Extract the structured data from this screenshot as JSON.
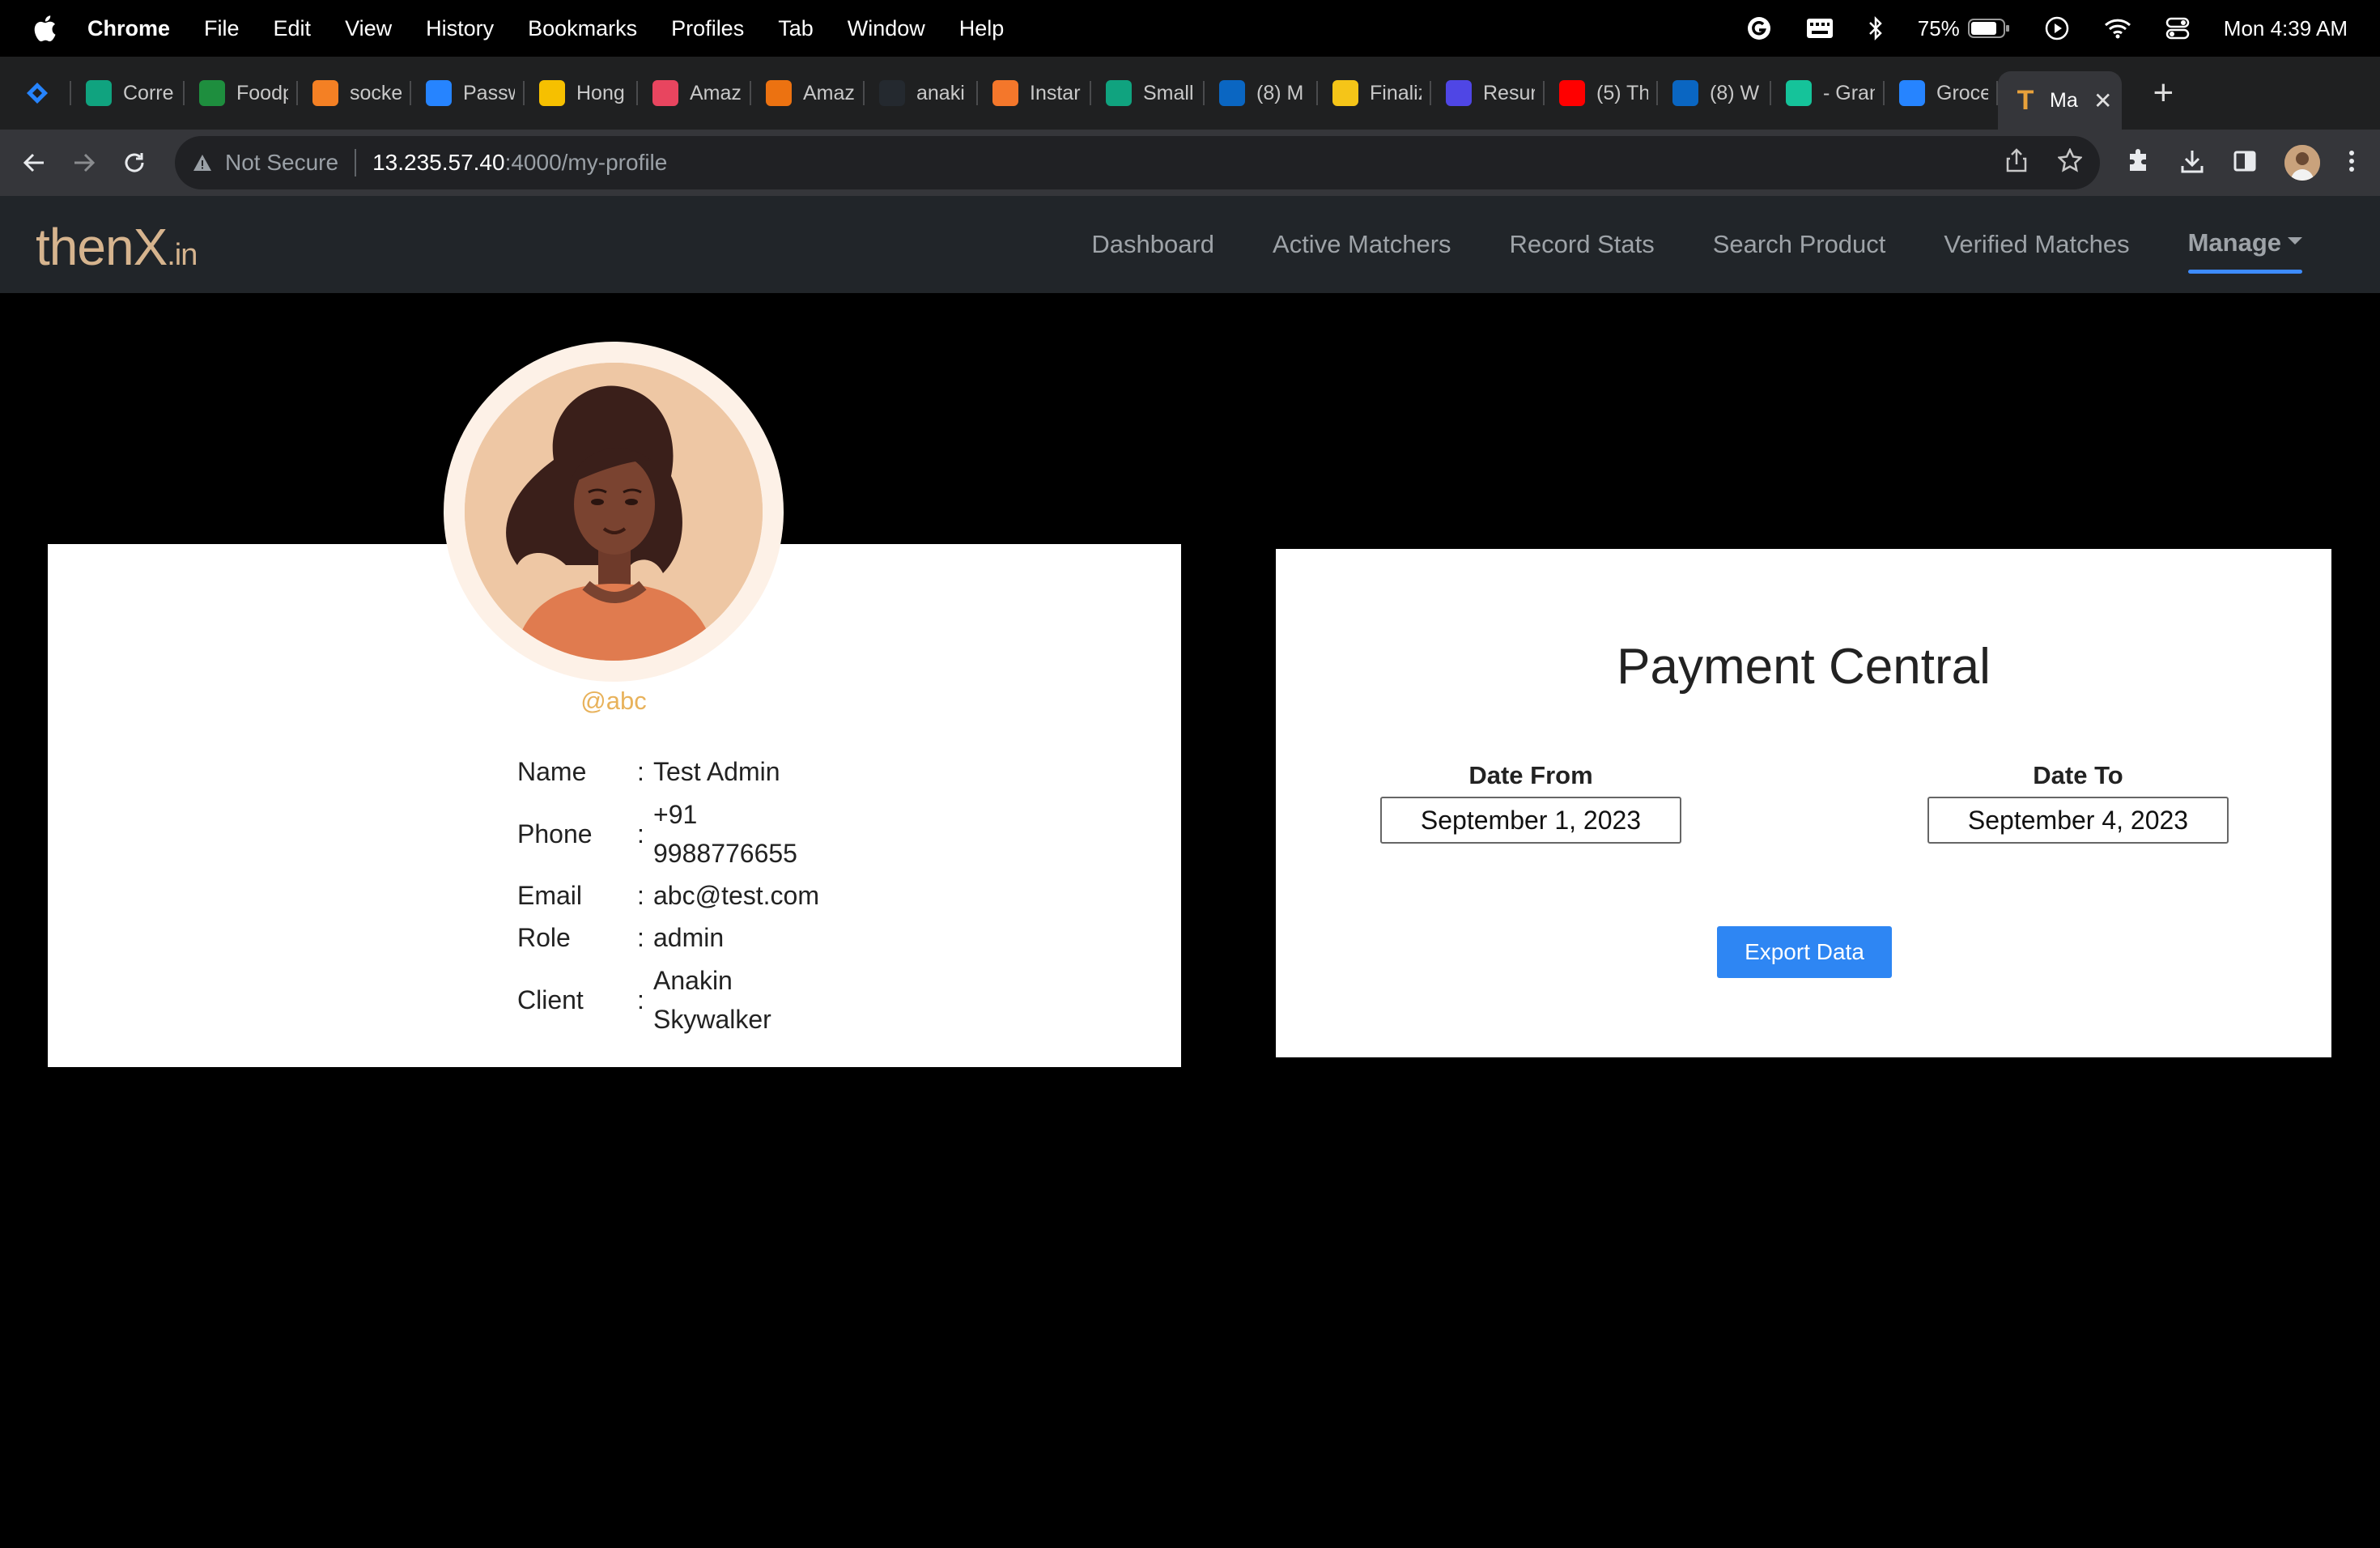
{
  "menubar": {
    "app": "Chrome",
    "items": [
      "File",
      "Edit",
      "View",
      "History",
      "Bookmarks",
      "Profiles",
      "Tab",
      "Window",
      "Help"
    ],
    "battery": "75%",
    "clock": "Mon 4:39 AM"
  },
  "tabs": [
    {
      "label": "",
      "color": "#1f6feb"
    },
    {
      "label": "Corre",
      "color": "#10a37f"
    },
    {
      "label": "Foodp",
      "color": "#1e8e3e"
    },
    {
      "label": "socke",
      "color": "#f48024"
    },
    {
      "label": "Passw",
      "color": "#2684ff"
    },
    {
      "label": "Hong",
      "color": "#f6c000"
    },
    {
      "label": "Amaz",
      "color": "#e8455f"
    },
    {
      "label": "Amaz",
      "color": "#ec7211"
    },
    {
      "label": "anaki",
      "color": "#24292f"
    },
    {
      "label": "Instar",
      "color": "#f4772b"
    },
    {
      "label": "Small",
      "color": "#10a37f"
    },
    {
      "label": "(8) M",
      "color": "#0a66c2"
    },
    {
      "label": "Finaliz",
      "color": "#f5c518"
    },
    {
      "label": "Resur",
      "color": "#4f46e5"
    },
    {
      "label": "(5) Th",
      "color": "#ff0000"
    },
    {
      "label": "(8) W",
      "color": "#0a66c2"
    },
    {
      "label": "- Gran",
      "color": "#15c39a"
    },
    {
      "label": "Groce",
      "color": "#2684ff"
    }
  ],
  "active_tab": {
    "label": "Ma",
    "favicon_letter": "T",
    "color": "#e8a13a"
  },
  "address": {
    "security": "Not Secure",
    "host": "13.235.57.40",
    "path": ":4000/my-profile"
  },
  "site": {
    "logo_main": "thenX",
    "logo_suffix": ".in",
    "nav": [
      "Dashboard",
      "Active Matchers",
      "Record Stats",
      "Search Product",
      "Verified Matches"
    ],
    "manage": "Manage"
  },
  "profile": {
    "username": "@abc",
    "fields": [
      {
        "label": "Name",
        "value": "Test Admin"
      },
      {
        "label": "Phone",
        "value": "+91 9988776655"
      },
      {
        "label": "Email",
        "value": "abc@test.com"
      },
      {
        "label": "Role",
        "value": "admin"
      },
      {
        "label": "Client",
        "value": "Anakin Skywalker"
      }
    ],
    "colon": ":"
  },
  "payment": {
    "title": "Payment Central",
    "date_from_label": "Date From",
    "date_from_value": "September 1, 2023",
    "date_to_label": "Date To",
    "date_to_value": "September 4, 2023",
    "export_label": "Export Data"
  }
}
